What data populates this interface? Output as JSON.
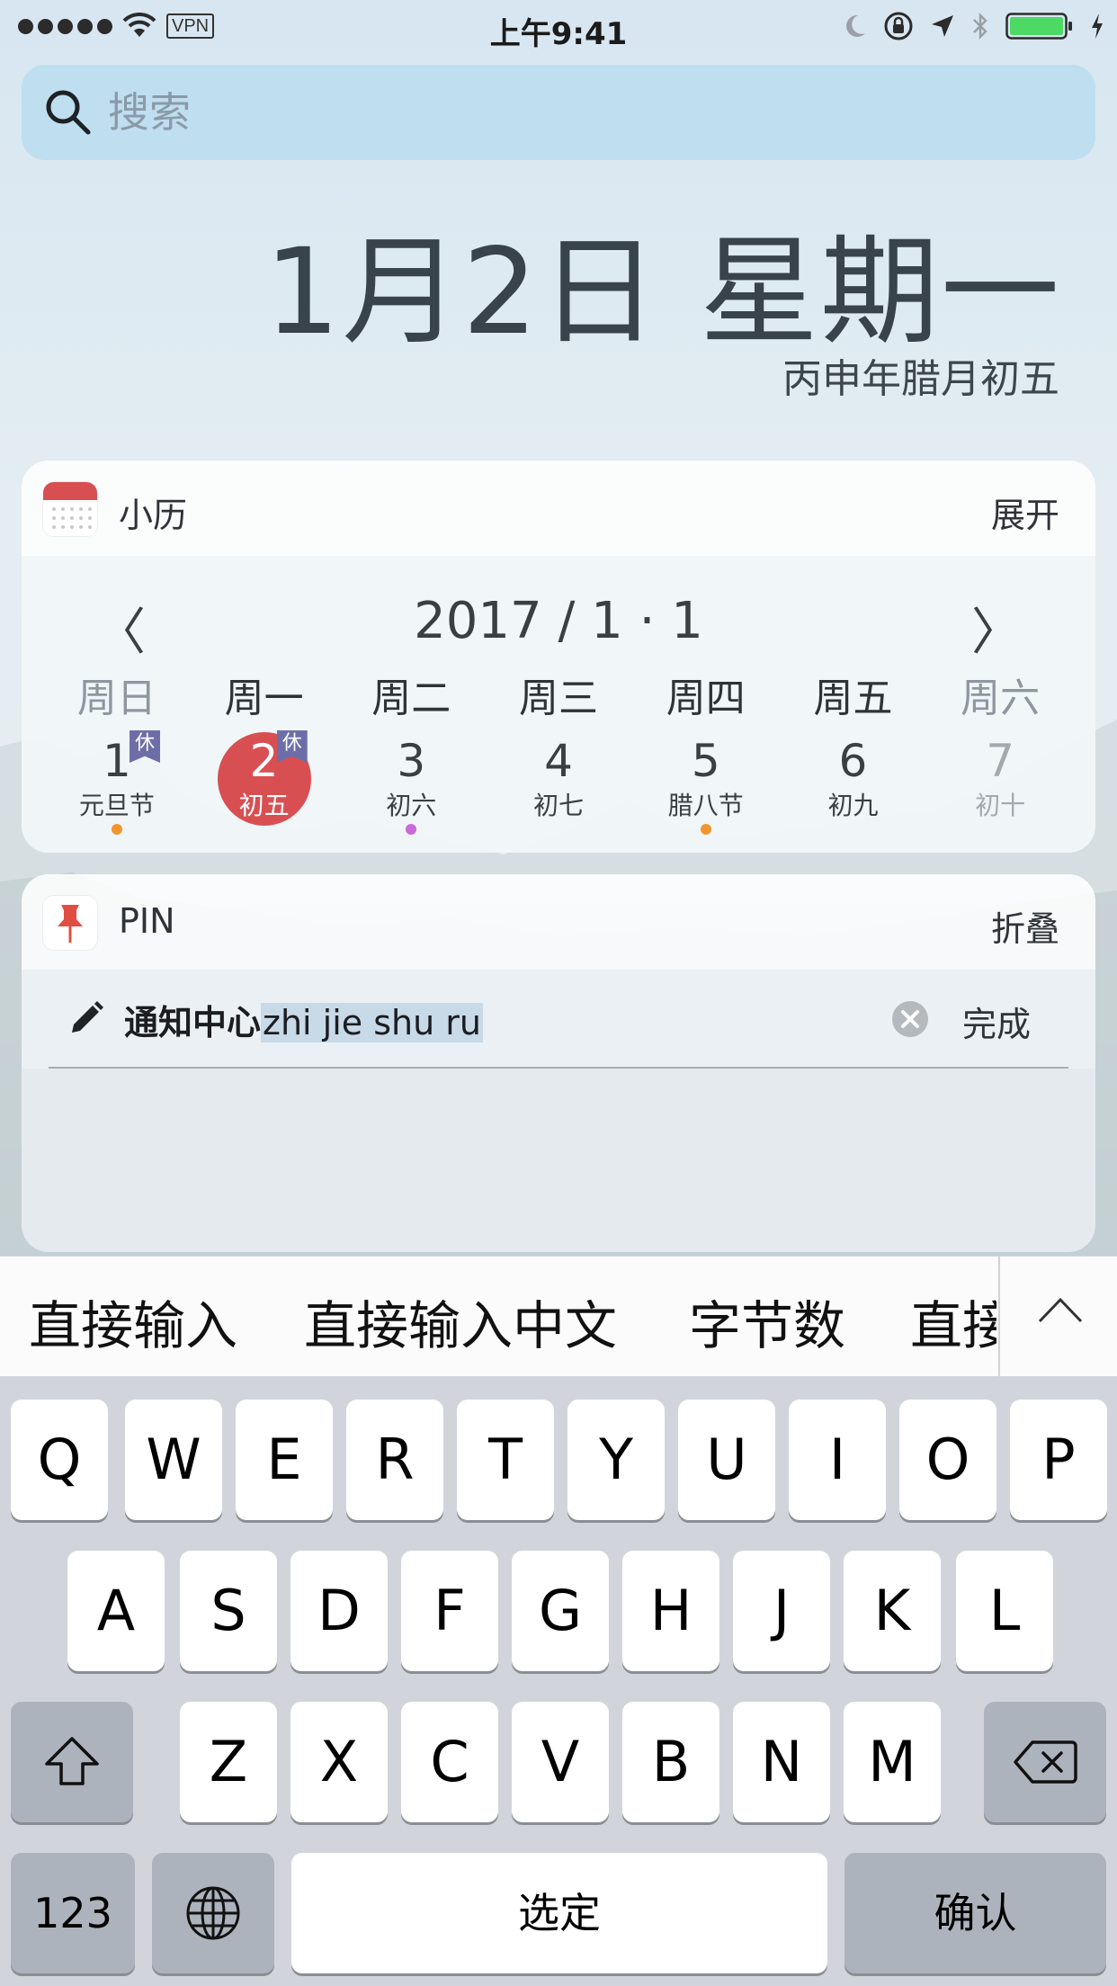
{
  "status_bar": {
    "vpn": "VPN",
    "time": "上午9:41"
  },
  "search": {
    "placeholder": "搜索"
  },
  "date_header": {
    "date": "1月2日 星期一",
    "lunar": "丙申年腊月初五"
  },
  "calendar_widget": {
    "app_name": "小历",
    "action": "展开",
    "prev": "〈",
    "next": "〉",
    "month_label": "2017 / 1 · 1",
    "weekdays": [
      "周日",
      "周一",
      "周二",
      "周三",
      "周四",
      "周五",
      "周六"
    ],
    "days": [
      {
        "num": "1",
        "sub": "元旦节",
        "badge": "休",
        "dot": "#f0952f"
      },
      {
        "num": "2",
        "sub": "初五",
        "badge": "休",
        "selected": true
      },
      {
        "num": "3",
        "sub": "初六",
        "dot": "#c86ad8"
      },
      {
        "num": "4",
        "sub": "初七"
      },
      {
        "num": "5",
        "sub": "腊八节",
        "dot": "#f0952f"
      },
      {
        "num": "6",
        "sub": "初九"
      },
      {
        "num": "7",
        "sub": "初十"
      }
    ],
    "colors": {
      "selected": "#d84f52",
      "badge": "#6d6ea8"
    }
  },
  "pin_widget": {
    "app_name": "PIN",
    "action": "折叠",
    "input_text": "通知中心",
    "input_marked": "zhi jie shu ru",
    "done": "完成"
  },
  "candidate_bar": {
    "candidates": [
      "直接输入",
      "直接输入中文",
      "字节数",
      "直接"
    ]
  },
  "keyboard": {
    "row1": [
      "Q",
      "W",
      "E",
      "R",
      "T",
      "Y",
      "U",
      "I",
      "O",
      "P"
    ],
    "row2": [
      "A",
      "S",
      "D",
      "F",
      "G",
      "H",
      "J",
      "K",
      "L"
    ],
    "row3": [
      "Z",
      "X",
      "C",
      "V",
      "B",
      "N",
      "M"
    ],
    "numbers_key": "123",
    "space_key": "选定",
    "return_key": "确认"
  }
}
